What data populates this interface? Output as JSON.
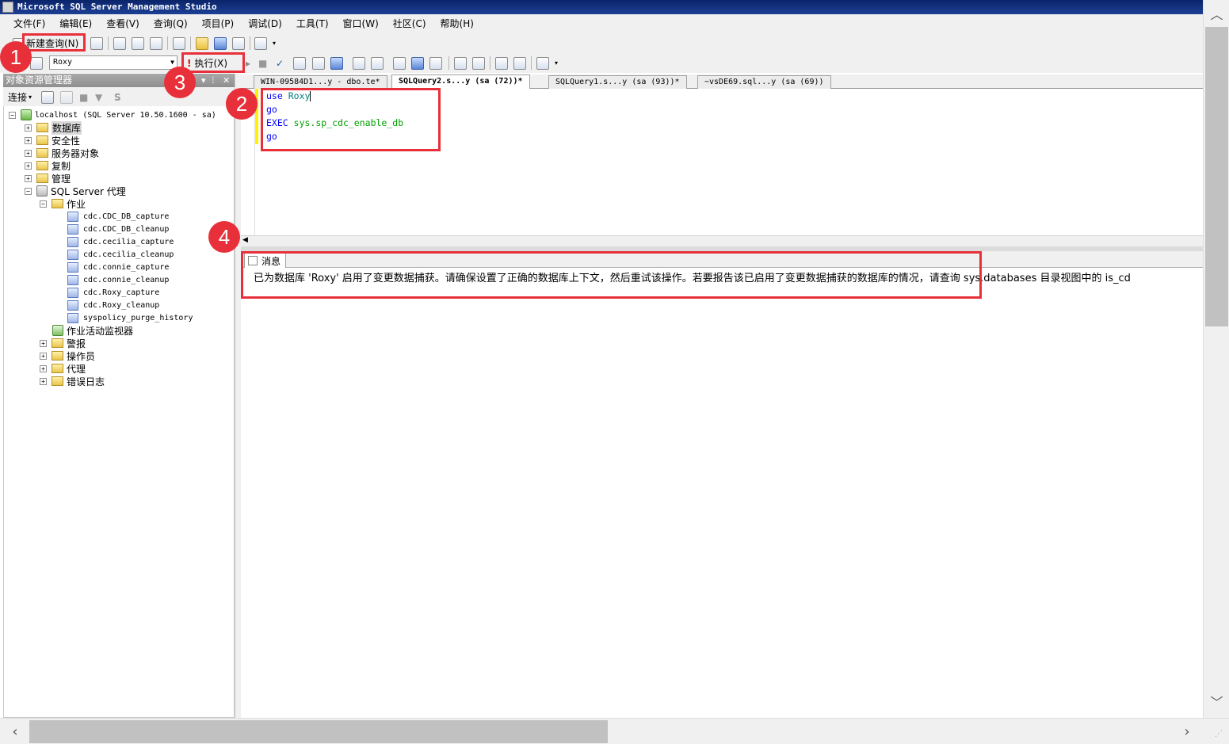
{
  "window": {
    "title": "Microsoft SQL Server Management Studio"
  },
  "menu": [
    "文件(F)",
    "编辑(E)",
    "查看(V)",
    "查询(Q)",
    "项目(P)",
    "调试(D)",
    "工具(T)",
    "窗口(W)",
    "社区(C)",
    "帮助(H)"
  ],
  "toolbar": {
    "new_query_label": "新建查询(N)",
    "database_selected": "Roxy",
    "execute_label": "执行(X)"
  },
  "object_explorer": {
    "title": "对象资源管理器",
    "connect_label": "连接",
    "controls": [
      "▾",
      "ⵗ",
      "✕"
    ],
    "tree": {
      "server": "localhost (SQL Server 10.50.1600 - sa)",
      "databases": "数据库",
      "security": "安全性",
      "server_objects": "服务器对象",
      "replication": "复制",
      "management": "管理",
      "agent": "SQL Server 代理",
      "jobs": "作业",
      "job_items": [
        "cdc.CDC_DB_capture",
        "cdc.CDC_DB_cleanup",
        "cdc.cecilia_capture",
        "cdc.cecilia_cleanup",
        "cdc.connie_capture",
        "cdc.connie_cleanup",
        "cdc.Roxy_capture",
        "cdc.Roxy_cleanup",
        "syspolicy_purge_history"
      ],
      "job_activity_monitor": "作业活动监视器",
      "alerts": "警报",
      "operators": "操作员",
      "proxies": "代理",
      "error_logs": "错误日志"
    }
  },
  "tabs": [
    "WIN-09584D1...y - dbo.te*",
    "SQLQuery2.s...y (sa (72))*",
    "SQLQuery1.s...y (sa (93))*",
    "~vsDE69.sql...y (sa (69))"
  ],
  "editor": {
    "line1_kw": "use",
    "line1_id": "Roxy",
    "line2": "go",
    "line3_kw": "EXEC",
    "line3_sys": "sys.sp_cdc_enable_db",
    "line4": "go"
  },
  "results": {
    "tab_label": "消息",
    "message": "已为数据库 'Roxy' 启用了变更数据捕获。请确保设置了正确的数据库上下文，然后重试该操作。若要报告该已启用了变更数据捕获的数据库的情况，请查询 sys.databases 目录视图中的 is_cd"
  },
  "annotations": [
    "1",
    "2",
    "3",
    "4"
  ],
  "colors": {
    "annotation_red": "#e8303a",
    "titlebar_blue": "#0a246a",
    "keyword_blue": "#0000ff",
    "system_green": "#00a000"
  }
}
